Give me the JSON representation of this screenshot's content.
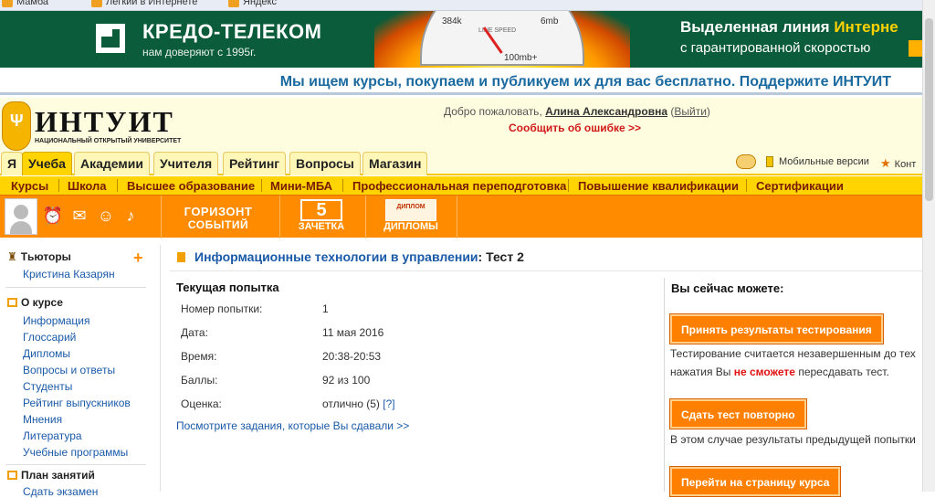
{
  "bookmarks": [
    "Мамба",
    "Легкий в Интернете",
    "Яндекс"
  ],
  "banner": {
    "brand": "КРЕДО-ТЕЛЕКОМ",
    "slogan": "нам доверяют с 1995г.",
    "gauge_left": "384k",
    "gauge_right": "6mb",
    "gauge_mid": "LINE SPEED",
    "gauge_bottom": "100mb+",
    "ad_line1_a": "Выделенная линия ",
    "ad_line1_b": "Интерне",
    "ad_line2": "с гарантированной скоростью"
  },
  "support_text": "Мы ищем курсы, покупаем и публикуем их для вас бесплатно. Поддержите ИНТУИТ",
  "header": {
    "logo_name": "ИНТУИТ",
    "logo_sub": "НАЦИОНАЛЬНЫЙ ОТКРЫТЫЙ УНИВЕРСИТЕТ",
    "welcome": "Добро пожаловать, ",
    "user_name": "Алина Александровна",
    "logout_open": " (",
    "logout": "Выйти",
    "logout_close": ")",
    "report_error": "Сообщить об ошибке >>"
  },
  "tabs": [
    "Я",
    "Учеба",
    "Академии",
    "Учителя",
    "Рейтинг",
    "Вопросы",
    "Магазин"
  ],
  "tabs_right": {
    "mobile": "Мобильные версии",
    "contacts": "Конт"
  },
  "subnav": [
    "Курсы",
    "Школа",
    "Высшее образование",
    "Мини-МБА",
    "Профессиональная переподготовка",
    "Повышение квалификации",
    "Сертификации"
  ],
  "toolbar": {
    "horizon_1": "ГОРИЗОНТ",
    "horizon_2": "СОБЫТИЙ",
    "zachet_num": "5",
    "zachet": "ЗАЧЕТКА",
    "diplom_tag": "ДИПЛОМ",
    "diplomy": "ДИПЛОМЫ"
  },
  "sidebar": {
    "tutors_h": "Тьюторы",
    "tutor": "Кристина Казарян",
    "about_h": "О курсе",
    "about_links": [
      "Информация",
      "Глоссарий",
      "Дипломы",
      "Вопросы и ответы",
      "Студенты",
      "Рейтинг выпускников",
      "Мнения",
      "Литература",
      "Учебные программы"
    ],
    "plan_h": "План занятий",
    "plan_first": "Сдать экзамен"
  },
  "main": {
    "course_link": "Информационные технологии в управлении",
    "title_suffix": ": Тест 2",
    "current_h": "Текущая попытка",
    "rows": [
      {
        "label": "Номер попытки:",
        "value": "1"
      },
      {
        "label": "Дата:",
        "value": "11 мая 2016"
      },
      {
        "label": "Время:",
        "value": "20:38-20:53"
      },
      {
        "label": "Баллы:",
        "value": "92 из 100"
      },
      {
        "label": "Оценка:",
        "value": "отлично (5) "
      }
    ],
    "grade_help": "[?]",
    "see_tasks": "Посмотрите задания, которые Вы сдавали >>"
  },
  "actions": {
    "heading": "Вы сейчас можете:",
    "accept_btn": "Принять результаты тестирования",
    "accept_note_1": "Тестирование считается незавершенным до тех",
    "accept_note_2a": "нажатия Вы ",
    "accept_note_2b": "не сможете",
    "accept_note_2c": " пересдавать тест.",
    "retake_btn": "Сдать тест повторно",
    "retake_note": "В этом случае результаты предыдущей попытки",
    "course_btn": "Перейти на страницу курса"
  }
}
